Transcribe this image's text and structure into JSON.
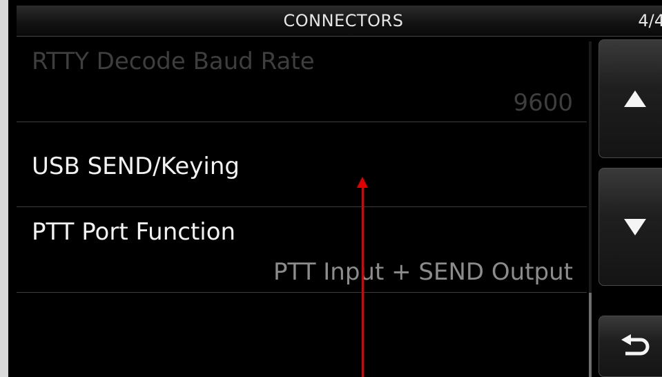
{
  "header": {
    "title": "CONNECTORS",
    "page_indicator": "4/4"
  },
  "menu": {
    "items": [
      {
        "label": "RTTY Decode Baud Rate",
        "value": "9600",
        "state": "disabled"
      },
      {
        "label": "USB SEND/Keying",
        "value": "",
        "state": "enabled"
      },
      {
        "label": "PTT Port Function",
        "value": "PTT Input + SEND Output",
        "state": "enabled"
      },
      {
        "label": "",
        "value": "",
        "state": "empty"
      }
    ]
  },
  "sidebar": {
    "up_icon": "triangle-up-icon",
    "down_icon": "triangle-down-icon",
    "back_icon": "return-arrow-icon"
  },
  "scrollbar": {
    "position_fraction": 0.75
  },
  "annotation": {
    "pointer_color": "#e00000"
  }
}
